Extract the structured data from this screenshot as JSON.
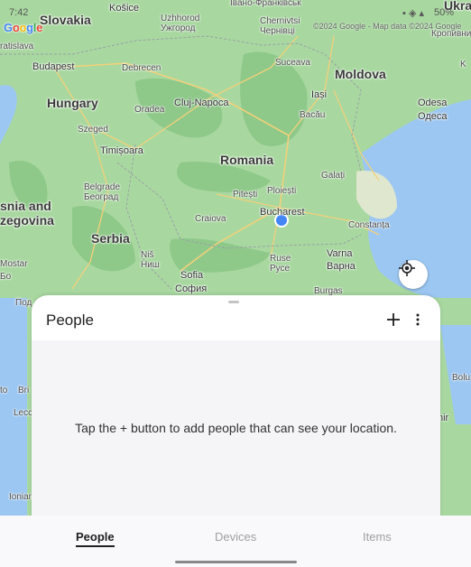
{
  "status_bar": {
    "time": "7:42",
    "battery": "50%"
  },
  "map": {
    "attribution": "©2024 Google - Map data ©2024 Google",
    "google_logo": "Google",
    "colors": {
      "land": "#a8d8a0",
      "forest": "#8fc98a",
      "water": "#9cc7f2",
      "roads": "#f3d07a",
      "location_dot": "#4285f4"
    },
    "labels": [
      {
        "t": "Košice",
        "c": "cityb"
      },
      {
        "t": "Slovakia",
        "c": "country"
      },
      {
        "t": "Uzhhorod",
        "c": "city"
      },
      {
        "t": "Ужгород",
        "c": "city"
      },
      {
        "t": "Chernivtsi",
        "c": "city"
      },
      {
        "t": "Чернівці",
        "c": "city"
      },
      {
        "t": "Івано-Франківськ",
        "c": "city"
      },
      {
        "t": "Ukrain",
        "c": "country"
      },
      {
        "t": "Кропивницьк",
        "c": "city"
      },
      {
        "t": "ratislava",
        "c": "city"
      },
      {
        "t": "Budapest",
        "c": "cityb"
      },
      {
        "t": "Debrecen",
        "c": "city"
      },
      {
        "t": "Suceava",
        "c": "city"
      },
      {
        "t": "Moldova",
        "c": "country"
      },
      {
        "t": "K",
        "c": "city"
      },
      {
        "t": "Hungary",
        "c": "country"
      },
      {
        "t": "Oradea",
        "c": "city"
      },
      {
        "t": "Cluj-Napoca",
        "c": "cityb"
      },
      {
        "t": "Iași",
        "c": "cityb"
      },
      {
        "t": "Bacău",
        "c": "city"
      },
      {
        "t": "Odesa",
        "c": "cityb"
      },
      {
        "t": "Одеса",
        "c": "cityb"
      },
      {
        "t": "Szeged",
        "c": "city"
      },
      {
        "t": "Timișoara",
        "c": "cityb"
      },
      {
        "t": "Romania",
        "c": "country"
      },
      {
        "t": "Galați",
        "c": "city"
      },
      {
        "t": "Belgrade",
        "c": "city"
      },
      {
        "t": "Београд",
        "c": "city"
      },
      {
        "t": "Pitești",
        "c": "city"
      },
      {
        "t": "Ploiești",
        "c": "city"
      },
      {
        "t": "snia and",
        "c": "country"
      },
      {
        "t": "zegovina",
        "c": "country"
      },
      {
        "t": "Bucharest",
        "c": "cityb"
      },
      {
        "t": "Craiova",
        "c": "city"
      },
      {
        "t": "Constanța",
        "c": "city"
      },
      {
        "t": "Serbia",
        "c": "country"
      },
      {
        "t": "Niš",
        "c": "city"
      },
      {
        "t": "Ниш",
        "c": "city"
      },
      {
        "t": "Varna",
        "c": "cityb"
      },
      {
        "t": "Варна",
        "c": "cityb"
      },
      {
        "t": "Ruse",
        "c": "city"
      },
      {
        "t": "Русе",
        "c": "city"
      },
      {
        "t": "Mostar",
        "c": "city"
      },
      {
        "t": "Sofia",
        "c": "cityb"
      },
      {
        "t": "София",
        "c": "cityb"
      },
      {
        "t": "Burgas",
        "c": "city"
      },
      {
        "t": "Бо",
        "c": "city"
      },
      {
        "t": "Под",
        "c": "city"
      },
      {
        "t": "to",
        "c": "city"
      },
      {
        "t": "Bri",
        "c": "city"
      },
      {
        "t": "Bolu",
        "c": "city"
      },
      {
        "t": "Lecc",
        "c": "city"
      },
      {
        "t": "nir",
        "c": "cityb"
      },
      {
        "t": "Ionian",
        "c": "city"
      }
    ]
  },
  "sheet": {
    "title": "People",
    "add_icon": "plus-icon",
    "more_icon": "more-vert-icon",
    "empty_text": "Tap the + button to add people that can see your location."
  },
  "nav": {
    "tabs": [
      {
        "label": "People",
        "active": true
      },
      {
        "label": "Devices",
        "active": false
      },
      {
        "label": "Items",
        "active": false
      }
    ]
  }
}
